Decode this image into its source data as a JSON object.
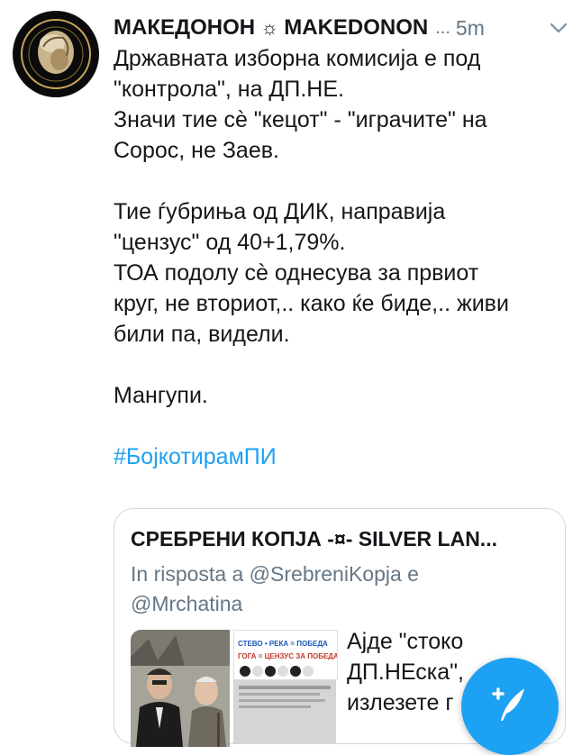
{
  "tweet": {
    "display_name": "МАКЕДОНОН",
    "separator_symbol": "☼",
    "handle": "MAKEDONON",
    "ellipsis": "...",
    "time": "5m",
    "body_lines": [
      "Државната изборна комисија е под",
      "\"контрола\", на ДП.НЕ.",
      "Значи тие сѐ \"кецот\" - \"играчите\" на",
      "Сорос, не Заев.",
      "",
      "Тие ѓубриња од ДИК, направија",
      "\"цензус\" од 40+1,79%.",
      "ТОА подолу сѐ однесува за првиот",
      "круг, не вториот,.. како ќе биде,.. живи",
      "били па, видели.",
      "",
      "Мангупи.",
      ""
    ],
    "hashtag": "#БојкотирамПИ"
  },
  "quoted": {
    "name": "СРЕБРЕНИ КОПЈА -¤- SILVER LAN...",
    "reply_line1": "In risposta a @SrebreniKopja e",
    "reply_line2": "@Mrchatina",
    "image_caption1": "СТЕВО • РЕКА = ПОБЕДА",
    "image_caption2": "ГОГА = ЦЕНЗУС ЗА ПОБЕДА",
    "text_lines": [
      "Ајде \"стоко",
      "ДП.НЕска\",",
      "излезете г"
    ]
  },
  "colors": {
    "accent": "#1da1f2",
    "text": "#14171a",
    "muted": "#657786"
  },
  "icons": {
    "chevron": "chevron-down-icon",
    "compose": "compose-feather-icon",
    "avatar": "avatar-emblem"
  }
}
